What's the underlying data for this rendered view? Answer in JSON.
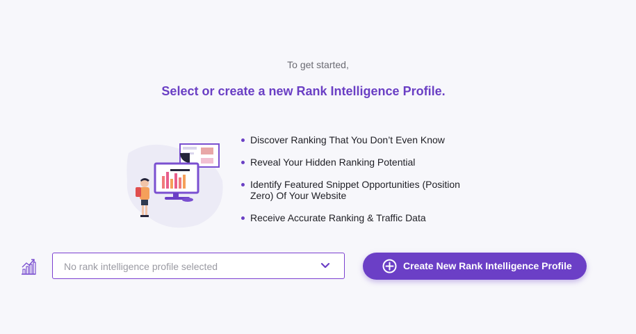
{
  "intro": "To get started,",
  "headline": "Select or create a new Rank Intelligence Profile.",
  "features": [
    "Discover Ranking That You Don’t Even Know",
    "Reveal Your Hidden Ranking Potential",
    "Identify Featured Snippet Opportunities (Position Zero) Of Your Website",
    "Receive Accurate Ranking & Traffic Data"
  ],
  "profile_select": {
    "placeholder": "No rank intelligence profile selected",
    "icon": "chevron-down-icon"
  },
  "create_button": {
    "label": "Create New Rank Intelligence Profile",
    "icon": "plus-circle-icon"
  },
  "colors": {
    "accent": "#6b3fc6",
    "headline": "#6a3fc4",
    "background": "#f7f7fb"
  }
}
